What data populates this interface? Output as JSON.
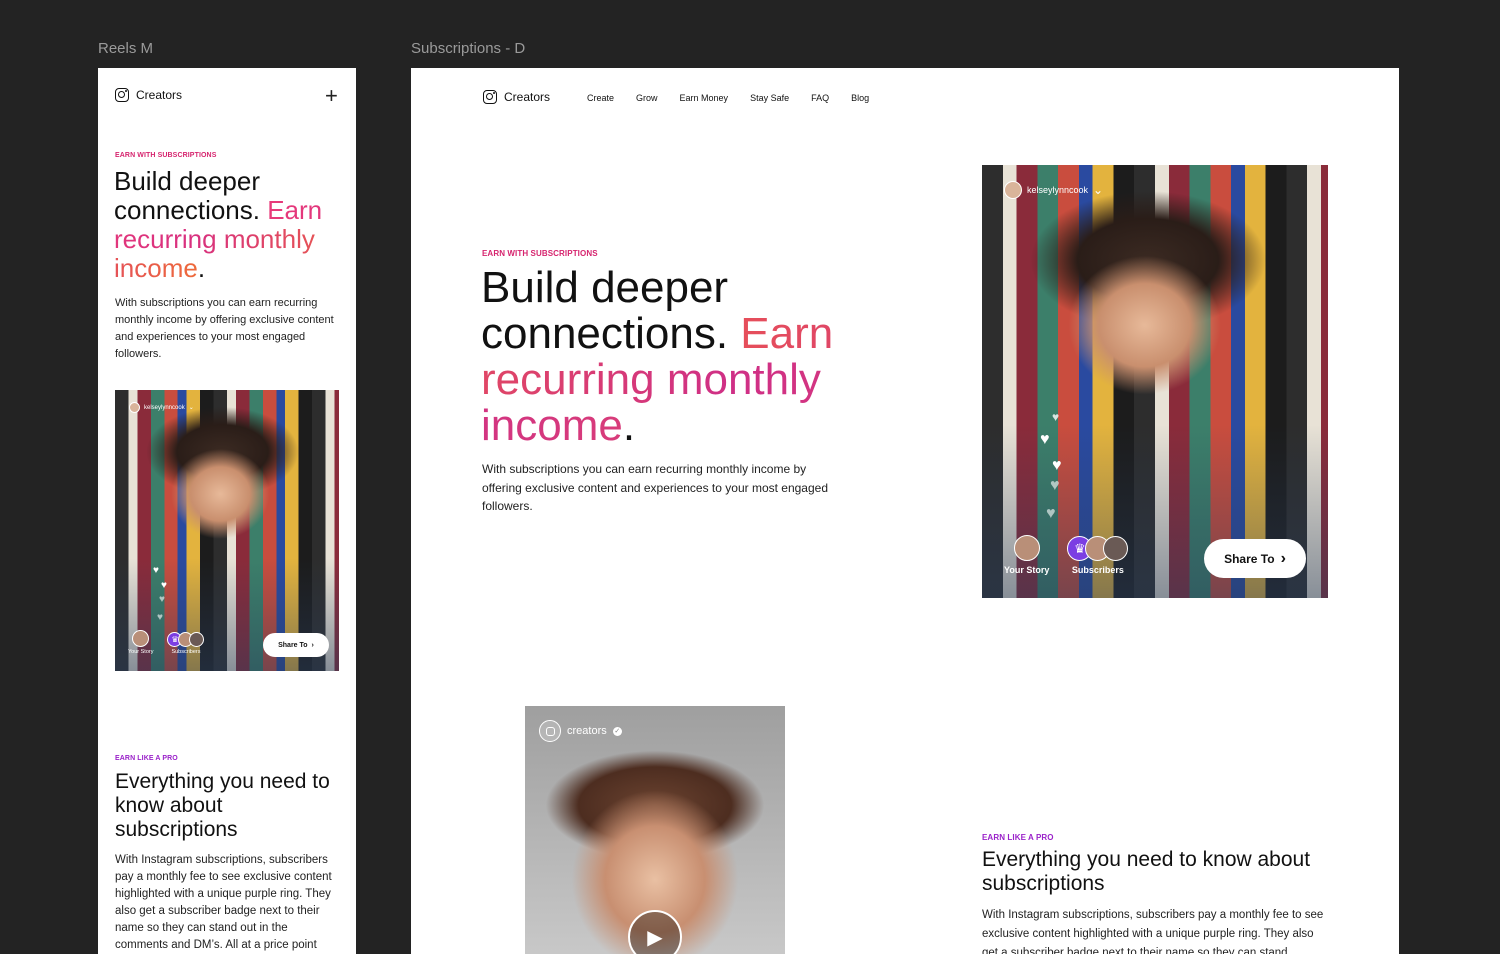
{
  "frames": {
    "mobile_label": "Reels M",
    "desktop_label": "Subscriptions - D"
  },
  "brand": {
    "name": "Creators",
    "icon": "instagram-icon"
  },
  "nav": [
    "Create",
    "Grow",
    "Earn Money",
    "Stay Safe",
    "FAQ",
    "Blog"
  ],
  "hero": {
    "eyebrow": "EARN WITH SUBSCRIPTIONS",
    "headline_plain": "Build deeper connections.",
    "headline_highlight": "Earn recurring monthly income",
    "headline_end": ".",
    "body": "With subscriptions you can earn recurring monthly income by offering exclusive content and experiences to your most engaged followers."
  },
  "story": {
    "username": "kelseylynncook",
    "your_story": "Your Story",
    "subscribers": "Subscribers",
    "share_label": "Share To",
    "accent": "#7b3ee3"
  },
  "video": {
    "account": "creators"
  },
  "section2": {
    "eyebrow": "EARN LIKE A PRO",
    "title": "Everything you need to know about subscriptions",
    "body_mobile": "With Instagram subscriptions, subscribers pay a monthly fee to see exclusive content highlighted with a unique purple ring. They also get a subscriber badge next to their name so they can stand out in the comments and DM’s. All at a price point",
    "body_desktop": "With Instagram subscriptions, subscribers pay a monthly fee to see exclusive content highlighted with a unique purple ring. They also get a subscriber badge next to their name so they can stand"
  },
  "colors": {
    "canvas": "#232323",
    "eyebrow_pink": "#d6246e",
    "eyebrow_purple": "#9a21c9"
  }
}
